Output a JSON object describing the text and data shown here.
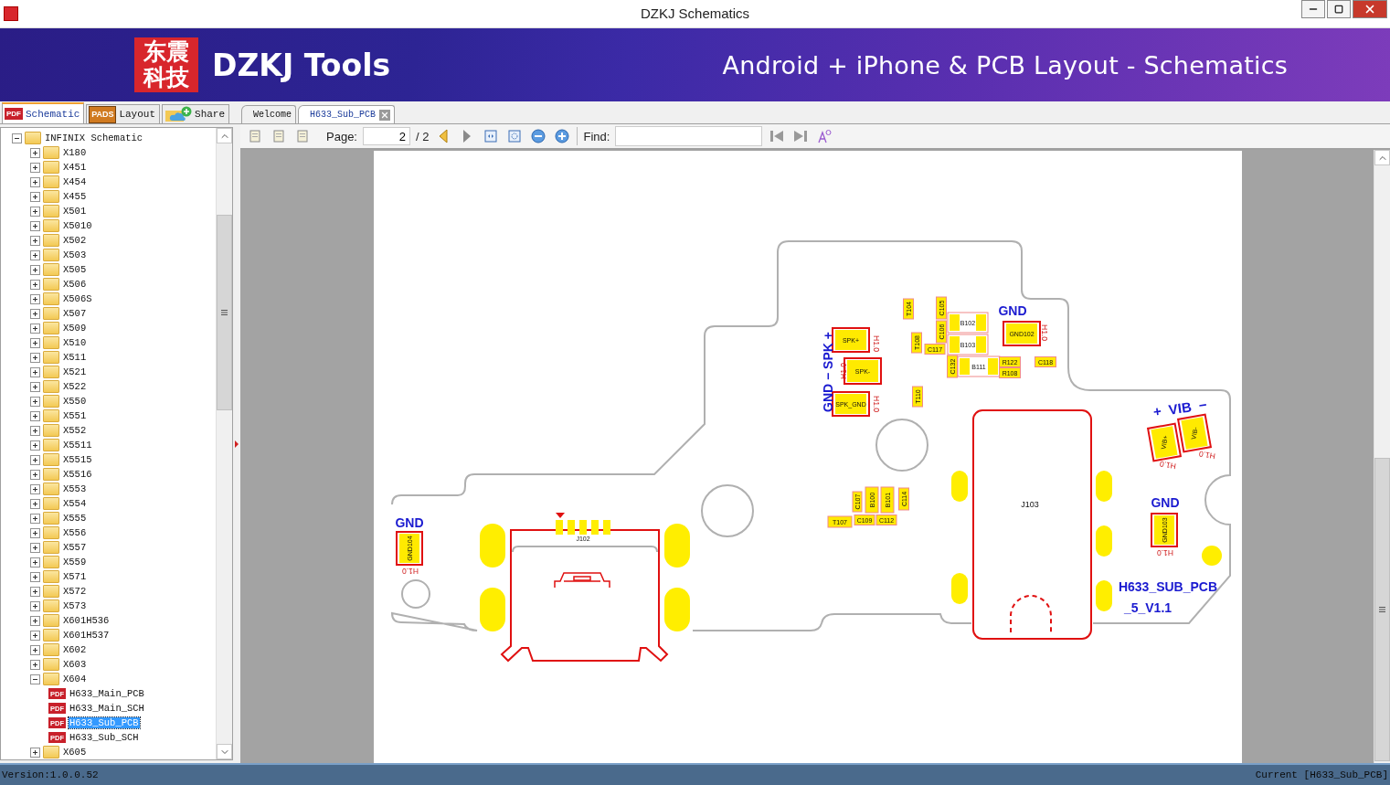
{
  "window": {
    "title": "DZKJ Schematics"
  },
  "banner": {
    "logo": "东震科技",
    "brand": "DZKJ Tools",
    "tagline": "Android + iPhone & PCB Layout - Schematics"
  },
  "side_tabs": [
    {
      "label": "Schematic",
      "selected": true,
      "kind": "pdf",
      "badge": "PDF"
    },
    {
      "label": "Layout",
      "selected": false,
      "kind": "pads",
      "badge": "PADS"
    },
    {
      "label": "Share",
      "selected": false,
      "kind": "cloud"
    }
  ],
  "doc_tabs": [
    {
      "label": "Welcome",
      "selected": false,
      "closable": false
    },
    {
      "label": "H633_Sub_PCB",
      "selected": true,
      "closable": true
    }
  ],
  "toolbar": {
    "page_label": "Page:",
    "page_value": "2",
    "page_total": "/ 2",
    "find_label": "Find:"
  },
  "tree": {
    "label": "INFINIX Schematic",
    "kind": "folder",
    "expanded": true,
    "selected": false,
    "children": [
      {
        "label": "X180",
        "kind": "folder",
        "expanded": false,
        "selected": false
      },
      {
        "label": "X451",
        "kind": "folder",
        "expanded": false,
        "selected": false
      },
      {
        "label": "X454",
        "kind": "folder",
        "expanded": false,
        "selected": false
      },
      {
        "label": "X455",
        "kind": "folder",
        "expanded": false,
        "selected": false
      },
      {
        "label": "X501",
        "kind": "folder",
        "expanded": false,
        "selected": false
      },
      {
        "label": "X5010",
        "kind": "folder",
        "expanded": false,
        "selected": false
      },
      {
        "label": "X502",
        "kind": "folder",
        "expanded": false,
        "selected": false
      },
      {
        "label": "X503",
        "kind": "folder",
        "expanded": false,
        "selected": false
      },
      {
        "label": "X505",
        "kind": "folder",
        "expanded": false,
        "selected": false
      },
      {
        "label": "X506",
        "kind": "folder",
        "expanded": false,
        "selected": false
      },
      {
        "label": "X506S",
        "kind": "folder",
        "expanded": false,
        "selected": false
      },
      {
        "label": "X507",
        "kind": "folder",
        "expanded": false,
        "selected": false
      },
      {
        "label": "X509",
        "kind": "folder",
        "expanded": false,
        "selected": false
      },
      {
        "label": "X510",
        "kind": "folder",
        "expanded": false,
        "selected": false
      },
      {
        "label": "X511",
        "kind": "folder",
        "expanded": false,
        "selected": false
      },
      {
        "label": "X521",
        "kind": "folder",
        "expanded": false,
        "selected": false
      },
      {
        "label": "X522",
        "kind": "folder",
        "expanded": false,
        "selected": false
      },
      {
        "label": "X550",
        "kind": "folder",
        "expanded": false,
        "selected": false
      },
      {
        "label": "X551",
        "kind": "folder",
        "expanded": false,
        "selected": false
      },
      {
        "label": "X552",
        "kind": "folder",
        "expanded": false,
        "selected": false
      },
      {
        "label": "X5511",
        "kind": "folder",
        "expanded": false,
        "selected": false
      },
      {
        "label": "X5515",
        "kind": "folder",
        "expanded": false,
        "selected": false
      },
      {
        "label": "X5516",
        "kind": "folder",
        "expanded": false,
        "selected": false
      },
      {
        "label": "X553",
        "kind": "folder",
        "expanded": false,
        "selected": false
      },
      {
        "label": "X554",
        "kind": "folder",
        "expanded": false,
        "selected": false
      },
      {
        "label": "X555",
        "kind": "folder",
        "expanded": false,
        "selected": false
      },
      {
        "label": "X556",
        "kind": "folder",
        "expanded": false,
        "selected": false
      },
      {
        "label": "X557",
        "kind": "folder",
        "expanded": false,
        "selected": false
      },
      {
        "label": "X559",
        "kind": "folder",
        "expanded": false,
        "selected": false
      },
      {
        "label": "X571",
        "kind": "folder",
        "expanded": false,
        "selected": false
      },
      {
        "label": "X572",
        "kind": "folder",
        "expanded": false,
        "selected": false
      },
      {
        "label": "X573",
        "kind": "folder",
        "expanded": false,
        "selected": false
      },
      {
        "label": "X601H536",
        "kind": "folder",
        "expanded": false,
        "selected": false
      },
      {
        "label": "X601H537",
        "kind": "folder",
        "expanded": false,
        "selected": false
      },
      {
        "label": "X602",
        "kind": "folder",
        "expanded": false,
        "selected": false
      },
      {
        "label": "X603",
        "kind": "folder",
        "expanded": false,
        "selected": false
      },
      {
        "label": "X604",
        "kind": "folder",
        "expanded": true,
        "selected": false,
        "children": [
          {
            "label": "H633_Main_PCB",
            "kind": "pdf",
            "badge": "PDF",
            "selected": false
          },
          {
            "label": "H633_Main_SCH",
            "kind": "pdf",
            "badge": "PDF",
            "selected": false
          },
          {
            "label": "H633_Sub_PCB",
            "kind": "pdf",
            "badge": "PDF",
            "selected": true
          },
          {
            "label": "H633_Sub_SCH",
            "kind": "pdf",
            "badge": "PDF",
            "selected": false
          }
        ]
      },
      {
        "label": "X605",
        "kind": "folder",
        "expanded": false,
        "selected": false
      }
    ]
  },
  "pcb": {
    "net_labels": [
      "GND",
      "GND",
      "GND",
      "GND − SPK +",
      "+  VIB  −",
      "H633_SUB_PCB",
      "_5_V1.1"
    ],
    "components": [
      {
        "ref": "SPK+",
        "kind": "pad",
        "note": "H1.0"
      },
      {
        "ref": "SPK-",
        "kind": "pad",
        "note": "H1.0"
      },
      {
        "ref": "SPK_GND",
        "kind": "pad",
        "note": "H1.0"
      },
      {
        "ref": "GND102",
        "kind": "pad",
        "note": "H1.0"
      },
      {
        "ref": "VIB+",
        "kind": "pad",
        "note": "H1.0"
      },
      {
        "ref": "VIB-",
        "kind": "pad",
        "note": "H1.0"
      },
      {
        "ref": "GND103",
        "kind": "pad",
        "note": "H1.0"
      },
      {
        "ref": "GND104",
        "kind": "pad",
        "note": "H1.0"
      },
      {
        "ref": "T104",
        "kind": "part"
      },
      {
        "ref": "T108",
        "kind": "part"
      },
      {
        "ref": "T110",
        "kind": "part"
      },
      {
        "ref": "C105",
        "kind": "part"
      },
      {
        "ref": "C106",
        "kind": "part"
      },
      {
        "ref": "B102",
        "kind": "chip"
      },
      {
        "ref": "B103",
        "kind": "chip"
      },
      {
        "ref": "C117",
        "kind": "part"
      },
      {
        "ref": "C132",
        "kind": "part"
      },
      {
        "ref": "B111",
        "kind": "chip"
      },
      {
        "ref": "R122",
        "kind": "part"
      },
      {
        "ref": "R108",
        "kind": "part"
      },
      {
        "ref": "C118",
        "kind": "part"
      },
      {
        "ref": "T107",
        "kind": "part"
      },
      {
        "ref": "C107",
        "kind": "part"
      },
      {
        "ref": "B100",
        "kind": "part"
      },
      {
        "ref": "B101",
        "kind": "part"
      },
      {
        "ref": "C114",
        "kind": "part"
      },
      {
        "ref": "C109",
        "kind": "part"
      },
      {
        "ref": "C112",
        "kind": "part"
      },
      {
        "ref": "J103",
        "kind": "connector"
      },
      {
        "ref": "J102",
        "kind": "connector"
      }
    ]
  },
  "status_bar": {
    "version": "Version:1.0.0.52",
    "current": "Current [H633_Sub_PCB]"
  }
}
